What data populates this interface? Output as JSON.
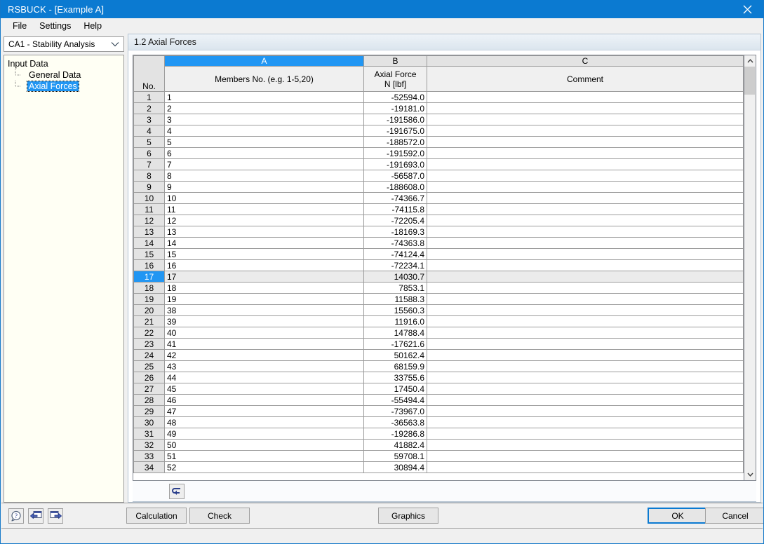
{
  "window": {
    "title": "RSBUCK - [Example A]",
    "close_icon": "close-icon",
    "titlebar_color": "#0b7ad1"
  },
  "menubar": {
    "items": [
      {
        "label": "File"
      },
      {
        "label": "Settings"
      },
      {
        "label": "Help"
      }
    ]
  },
  "sidebar": {
    "case_select": {
      "value": "CA1 - Stability Analysis",
      "icon": "chevron-down-icon"
    },
    "tree": {
      "root": "Input Data",
      "children": [
        {
          "label": "General Data",
          "selected": false
        },
        {
          "label": "Axial Forces",
          "selected": true
        }
      ]
    }
  },
  "panel": {
    "header": "1.2 Axial Forces",
    "toolbar": {
      "reset_icon": "arrow-return-icon"
    }
  },
  "table": {
    "letters": [
      "",
      "A",
      "B",
      "C"
    ],
    "active_letter": "A",
    "captions": {
      "no": "No.",
      "a": "Members No. (e.g. 1-5,20)",
      "b_line1": "Axial Force",
      "b_line2": "N [lbf]",
      "c": "Comment"
    },
    "selected_row": 17,
    "rows": [
      {
        "no": "1",
        "members": "1",
        "force": "-52594.0",
        "comment": ""
      },
      {
        "no": "2",
        "members": "2",
        "force": "-19181.0",
        "comment": ""
      },
      {
        "no": "3",
        "members": "3",
        "force": "-191586.0",
        "comment": ""
      },
      {
        "no": "4",
        "members": "4",
        "force": "-191675.0",
        "comment": ""
      },
      {
        "no": "5",
        "members": "5",
        "force": "-188572.0",
        "comment": ""
      },
      {
        "no": "6",
        "members": "6",
        "force": "-191592.0",
        "comment": ""
      },
      {
        "no": "7",
        "members": "7",
        "force": "-191693.0",
        "comment": ""
      },
      {
        "no": "8",
        "members": "8",
        "force": "-56587.0",
        "comment": ""
      },
      {
        "no": "9",
        "members": "9",
        "force": "-188608.0",
        "comment": ""
      },
      {
        "no": "10",
        "members": "10",
        "force": "-74366.7",
        "comment": ""
      },
      {
        "no": "11",
        "members": "11",
        "force": "-74115.8",
        "comment": ""
      },
      {
        "no": "12",
        "members": "12",
        "force": "-72205.4",
        "comment": ""
      },
      {
        "no": "13",
        "members": "13",
        "force": "-18169.3",
        "comment": ""
      },
      {
        "no": "14",
        "members": "14",
        "force": "-74363.8",
        "comment": ""
      },
      {
        "no": "15",
        "members": "15",
        "force": "-74124.4",
        "comment": ""
      },
      {
        "no": "16",
        "members": "16",
        "force": "-72234.1",
        "comment": ""
      },
      {
        "no": "17",
        "members": "17",
        "force": "14030.7",
        "comment": ""
      },
      {
        "no": "18",
        "members": "18",
        "force": "7853.1",
        "comment": ""
      },
      {
        "no": "19",
        "members": "19",
        "force": "11588.3",
        "comment": ""
      },
      {
        "no": "20",
        "members": "38",
        "force": "15560.3",
        "comment": ""
      },
      {
        "no": "21",
        "members": "39",
        "force": "11916.0",
        "comment": ""
      },
      {
        "no": "22",
        "members": "40",
        "force": "14788.4",
        "comment": ""
      },
      {
        "no": "23",
        "members": "41",
        "force": "-17621.6",
        "comment": ""
      },
      {
        "no": "24",
        "members": "42",
        "force": "50162.4",
        "comment": ""
      },
      {
        "no": "25",
        "members": "43",
        "force": "68159.9",
        "comment": ""
      },
      {
        "no": "26",
        "members": "44",
        "force": "33755.6",
        "comment": ""
      },
      {
        "no": "27",
        "members": "45",
        "force": "17450.4",
        "comment": ""
      },
      {
        "no": "28",
        "members": "46",
        "force": "-55494.4",
        "comment": ""
      },
      {
        "no": "29",
        "members": "47",
        "force": "-73967.0",
        "comment": ""
      },
      {
        "no": "30",
        "members": "48",
        "force": "-36563.8",
        "comment": ""
      },
      {
        "no": "31",
        "members": "49",
        "force": "-19286.8",
        "comment": ""
      },
      {
        "no": "32",
        "members": "50",
        "force": "41882.4",
        "comment": ""
      },
      {
        "no": "33",
        "members": "51",
        "force": "59708.1",
        "comment": ""
      },
      {
        "no": "34",
        "members": "52",
        "force": "30894.4",
        "comment": ""
      }
    ]
  },
  "scrollbar": {
    "up_icon": "chevron-up-icon",
    "down_icon": "chevron-down-icon"
  },
  "bottombar": {
    "help_icon": "help-question-icon",
    "prev_icon": "previous-window-icon",
    "next_icon": "next-window-icon",
    "calculation_label": "Calculation",
    "check_label": "Check",
    "graphics_label": "Graphics",
    "ok_label": "OK",
    "cancel_label": "Cancel",
    "focus_button": "OK"
  }
}
